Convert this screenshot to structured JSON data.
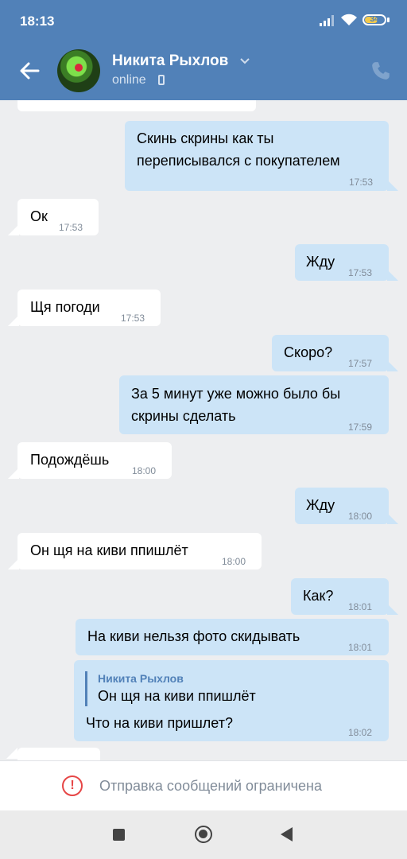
{
  "status_bar": {
    "time": "18:13",
    "battery": "34"
  },
  "header": {
    "contact_name": "Никита Рыхлов",
    "status": "online",
    "accent_color": "#5181b8"
  },
  "messages": [
    {
      "dir": "out",
      "text": [
        "Скинь скрины как ты",
        "переписывался с покупателем"
      ],
      "time": "17:53"
    },
    {
      "dir": "in",
      "text": [
        "Ок"
      ],
      "time": "17:53"
    },
    {
      "dir": "out",
      "text": [
        "Жду"
      ],
      "time": "17:53"
    },
    {
      "dir": "in",
      "text": [
        "Щя погоди"
      ],
      "time": "17:53"
    },
    {
      "dir": "out",
      "text": [
        "Скоро?"
      ],
      "time": "17:57"
    },
    {
      "dir": "out",
      "text": [
        "За 5 минут уже можно было бы",
        "скрины сделать"
      ],
      "time": "17:59"
    },
    {
      "dir": "in",
      "text": [
        "Подождёшь"
      ],
      "time": "18:00"
    },
    {
      "dir": "out",
      "text": [
        "Жду"
      ],
      "time": "18:00"
    },
    {
      "dir": "in",
      "text": [
        "Он щя на киви ппишлёт"
      ],
      "time": "18:00"
    },
    {
      "dir": "out",
      "text": [
        "Как?"
      ],
      "time": "18:01"
    },
    {
      "dir": "out",
      "text": [
        "На киви нельзя фото скидывать"
      ],
      "time": "18:01"
    },
    {
      "dir": "out",
      "reply_author": "Никита Рыхлов",
      "reply_text": "Он щя на киви ппишлёт",
      "text": [
        "Что на киви пришлет?"
      ],
      "time": "18:02"
    }
  ],
  "restriction": {
    "text": "Отправка сообщений ограничена",
    "icon": "warning-circle-icon"
  },
  "navbar": {
    "icons": [
      "recent-apps-icon",
      "home-icon",
      "back-icon"
    ]
  }
}
